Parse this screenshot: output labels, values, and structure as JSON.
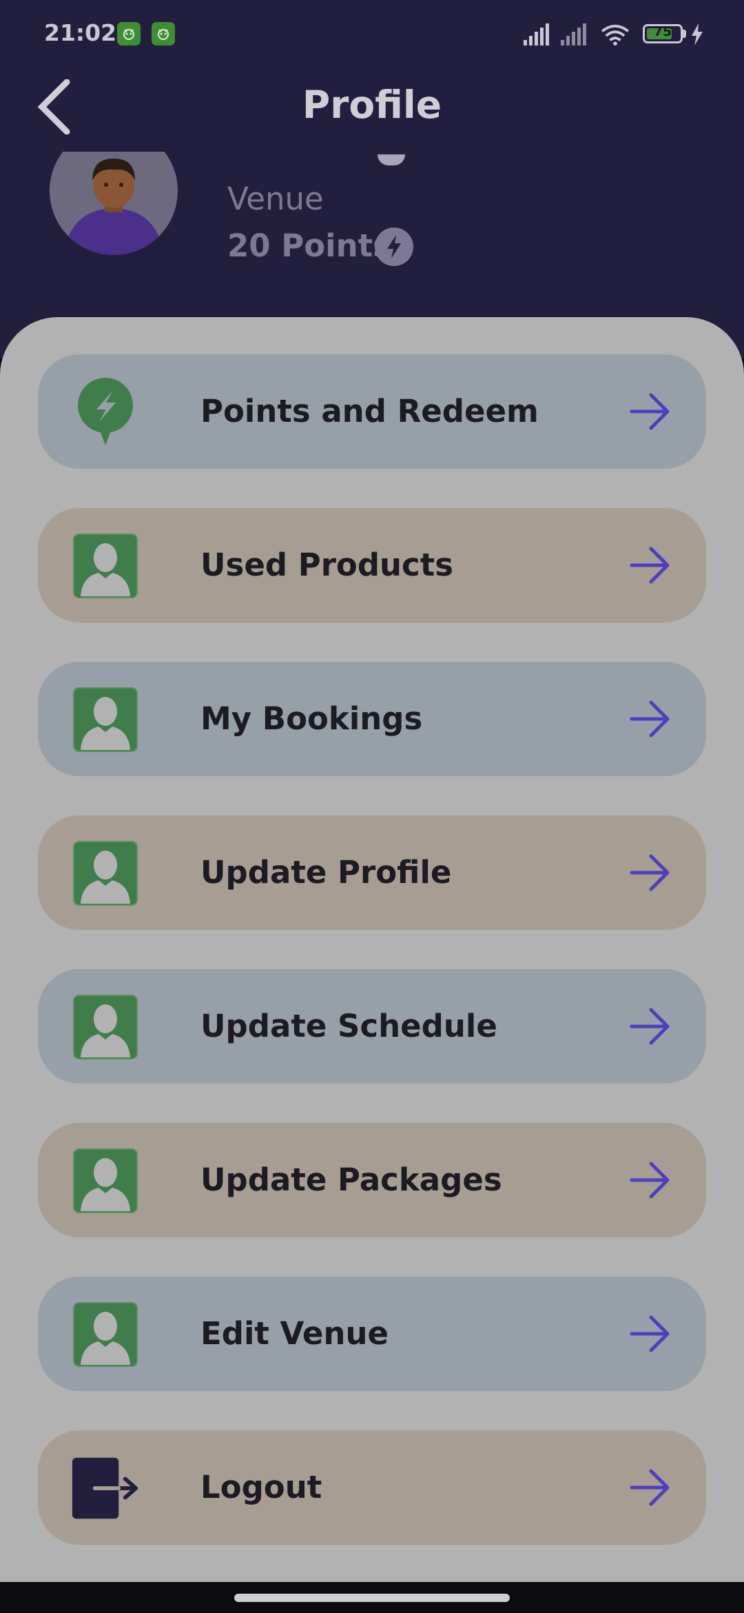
{
  "status_bar": {
    "time": "21:02",
    "battery": "75"
  },
  "header": {
    "title": "Profile",
    "back_icon": "chevron-left-icon",
    "venue": "Venue",
    "points": "20 Points",
    "points_icon": "lightning-icon"
  },
  "menu": {
    "items": [
      {
        "label": "Points and Redeem",
        "icon": "lightning-bubble-icon"
      },
      {
        "label": "Used Products",
        "icon": "contact-person-icon"
      },
      {
        "label": "My Bookings",
        "icon": "contact-person-icon"
      },
      {
        "label": "Update Profile",
        "icon": "contact-person-icon"
      },
      {
        "label": "Update Schedule",
        "icon": "contact-person-icon"
      },
      {
        "label": "Update Packages",
        "icon": "contact-person-icon"
      },
      {
        "label": "Edit Venue",
        "icon": "contact-person-icon"
      },
      {
        "label": "Logout",
        "icon": "logout-icon"
      }
    ],
    "arrow_icon": "arrow-right-icon"
  },
  "colors": {
    "header_bg": "#221e3e",
    "content_bg": "#b2b2b2",
    "item_blue": "#97a0a8",
    "item_tan": "#a79d92",
    "accent_green": "#3f7e4a",
    "arrow": "#4d3fbd"
  }
}
